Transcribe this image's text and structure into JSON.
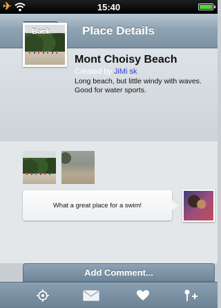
{
  "status_bar": {
    "time": "15:40"
  },
  "nav": {
    "back_label": "Back",
    "title": "Place Details"
  },
  "place": {
    "name": "Mont Choisy Beach",
    "created_by_prefix": "Created by ",
    "created_by_user": "JiMi sk",
    "description": "Long beach, but little windy with waves. Good for water sports."
  },
  "comments": [
    {
      "text": "What a great place for a swim!"
    }
  ],
  "actions": {
    "add_comment_label": "Add Comment..."
  },
  "tab_bar": {
    "icons": [
      "locate-icon",
      "mail-icon",
      "heart-icon",
      "add-pin-icon"
    ]
  },
  "colors": {
    "accent": "#7d93a4",
    "link": "#2a43d4",
    "battery": "#53d43a",
    "airplane": "#f1a73b"
  }
}
